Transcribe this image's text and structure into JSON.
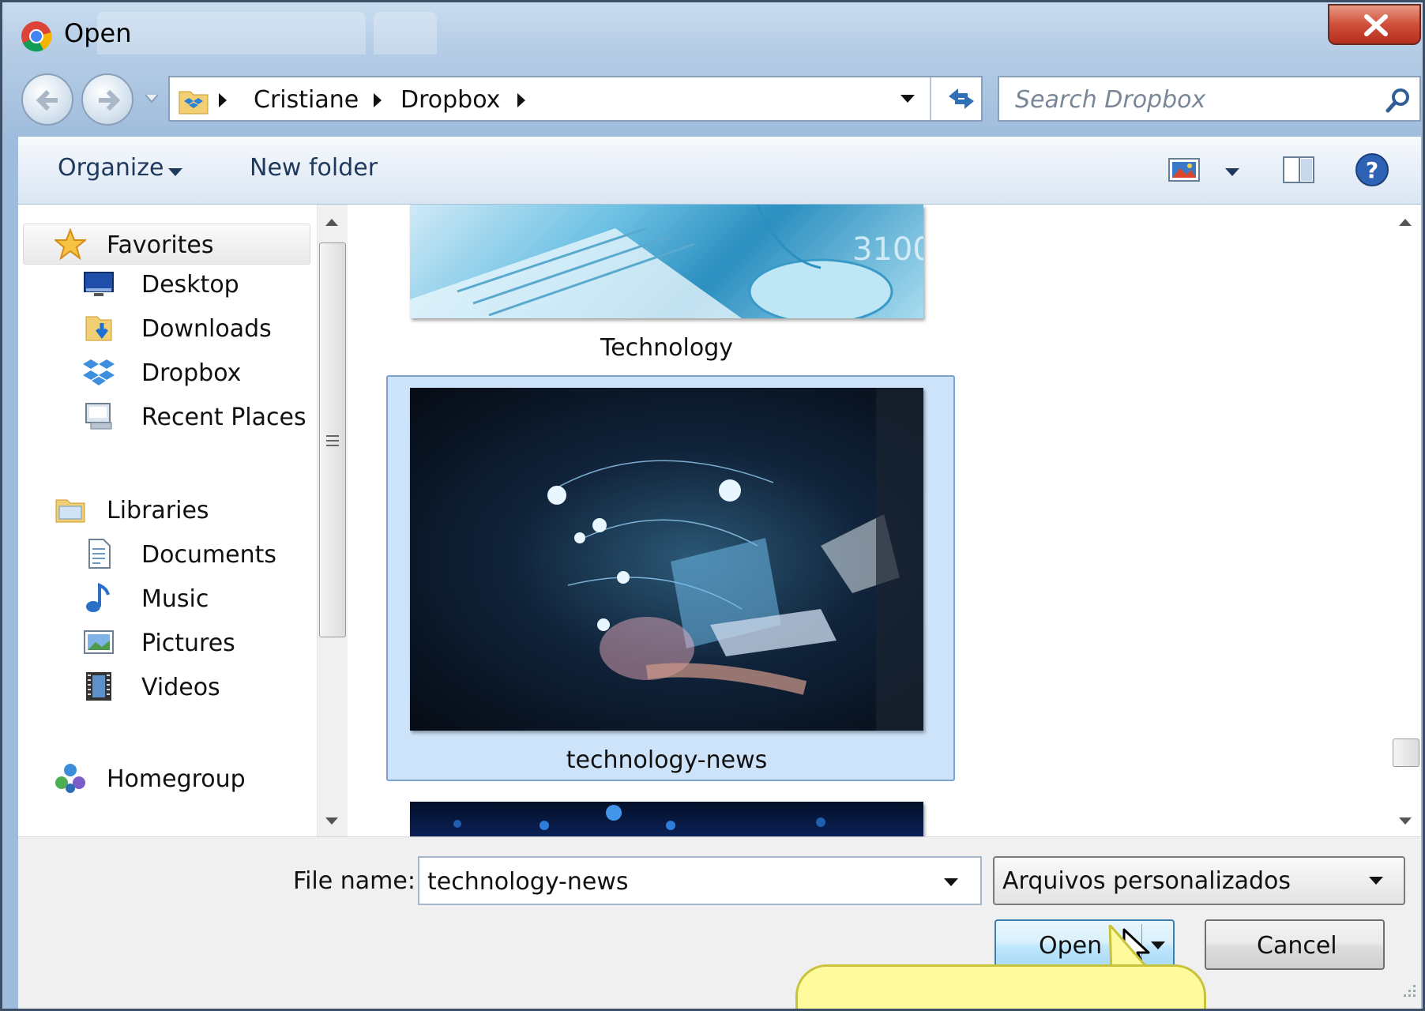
{
  "window": {
    "title": "Open"
  },
  "address": {
    "crumbs": [
      "Cristiane",
      "Dropbox"
    ],
    "search_placeholder": "Search Dropbox"
  },
  "toolbar": {
    "organize_label": "Organize",
    "new_folder_label": "New folder"
  },
  "sidebar": {
    "favorites_label": "Favorites",
    "favorites": [
      "Desktop",
      "Downloads",
      "Dropbox",
      "Recent Places"
    ],
    "libraries_label": "Libraries",
    "libraries": [
      "Documents",
      "Music",
      "Pictures",
      "Videos"
    ],
    "homegroup_label": "Homegroup"
  },
  "files": {
    "items": [
      {
        "label": "Technology"
      },
      {
        "label": "technology-news",
        "selected": true
      }
    ]
  },
  "footer": {
    "file_name_label": "File name:",
    "file_name_value": "technology-news",
    "file_type_value": "Arquivos personalizados",
    "open_label": "Open",
    "cancel_label": "Cancel"
  },
  "colors": {
    "selection": "#cde3f9",
    "close": "#c9412c",
    "toolbar_text": "#1e395b"
  }
}
